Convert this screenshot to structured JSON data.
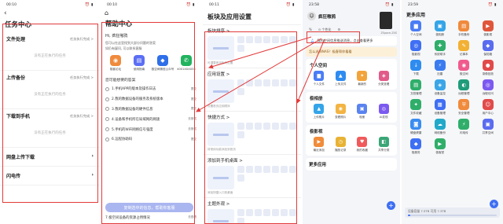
{
  "screen1": {
    "time": "00:10",
    "status_icons": "⏰ ▮",
    "title": "任务中心",
    "sections": [
      {
        "label": "文件处理",
        "right": "任务执行完成 >",
        "empty": "没有正在执行的任务"
      },
      {
        "label": "上传备份",
        "right": "任务执行完成 >",
        "empty": "没有正在执行的任务"
      },
      {
        "label": "下载到手机",
        "right": "任务执行完成 >",
        "empty": "没有正在执行的任务"
      }
    ],
    "items": [
      {
        "label": "网盘上传下载"
      },
      {
        "label": "闪电传"
      }
    ]
  },
  "screen2": {
    "time": "00:10",
    "title": "帮助中心",
    "hi": "Hi, 疯狂嗷鸦",
    "desc1": "您可以在这里找到大部分问题的答案",
    "desc2": "如仍有疑问, 可以联系客服",
    "apps": [
      {
        "label": "极客论坛",
        "icon": "forum-icon",
        "color": "#f08a3c",
        "glyph": "◉"
      },
      {
        "label": "使用指南",
        "icon": "guide-icon",
        "color": "#5b6ef5",
        "glyph": "▤"
      },
      {
        "label": "极空间微信公众号",
        "icon": "wechat-icon",
        "color": "#2f6fe8",
        "glyph": "◆"
      },
      {
        "label": "4001XXXX55",
        "icon": "phone-icon",
        "color": "#22b35e",
        "glyph": "✆"
      }
    ],
    "section": "您可能想要的答案",
    "questions": [
      {
        "label": "1.手机APP的版本及操作日志",
        "btn": "提交"
      },
      {
        "label": "2.我的数据设备的服务及系统版本",
        "btn": "提交"
      },
      {
        "label": "3.我的数据设备的硬件信息",
        "btn": "提交"
      },
      {
        "label": "4.设备和手机所在局域网的网速",
        "btn": "去测试"
      },
      {
        "label": "5.手机的WiFi网络信号强度",
        "btn": "去测试"
      },
      {
        "label": "6.远程协助码",
        "btn": "提交"
      }
    ],
    "big_button": "复制选中的信息，帮助你客服",
    "last_item": "7.极空间设备的资源占用情况",
    "last_btn": "去查看"
  },
  "screen3": {
    "time": "00:11",
    "title": "板块及应用设置",
    "modules": [
      {
        "label": "板块排序 >",
        "hint": "可调整首页板块位置"
      },
      {
        "label": "应用设置 >",
        "hint": "设置首页应用顺序"
      },
      {
        "label": "快捷方式 >",
        "hint": "将常用功能添加到首页"
      },
      {
        "label": "添加到手机桌面 >",
        "hint": "添加快捷入口到桌面"
      },
      {
        "label": "主题外观 >",
        "hint": ""
      }
    ]
  },
  "screen4": {
    "time": "23:58",
    "name": "疯狂嗷鸦",
    "nas_label": "ZSpace-Z4S",
    "stats": [
      "%",
      "⊙ 个性化",
      "⚙"
    ],
    "msg_item": "我的空间信息推送消息，点击查看更多",
    "banner": "怎么选择NAS？极客帮你看看",
    "blocks": [
      {
        "title": "个人空间",
        "apps": [
          {
            "label": "个人文件",
            "color": "#4a7df5",
            "glyph": "▆"
          },
          {
            "label": "上传文件",
            "color": "#2e8cf0",
            "glyph": "▲"
          },
          {
            "label": "最新的",
            "color": "#f2a43a",
            "glyph": "✦"
          },
          {
            "label": "分类查看",
            "color": "#e25a8a",
            "glyph": "◈"
          }
        ]
      },
      {
        "title": "极相册",
        "apps": [
          {
            "label": "上传照片",
            "color": "#34a5e8",
            "glyph": "▲"
          },
          {
            "label": "查看照片",
            "color": "#f3b443",
            "glyph": "◉"
          },
          {
            "label": "相册",
            "color": "#5a83f0",
            "glyph": "▣"
          },
          {
            "label": "AI发现",
            "color": "#7c5af0",
            "glyph": "◎"
          }
        ]
      },
      {
        "title": "极影视",
        "apps": [
          {
            "label": "最近添加",
            "color": "#f08c3a",
            "glyph": "▶"
          },
          {
            "label": "播放记录",
            "color": "#e8b234",
            "glyph": "◷"
          },
          {
            "label": "我的收藏",
            "color": "#f05a5a",
            "glyph": "♥"
          },
          {
            "label": "共享分类",
            "color": "#3aa676",
            "glyph": "◧"
          }
        ]
      }
    ],
    "more_title": "更多应用"
  },
  "screen5": {
    "time": "23:59",
    "title": "更多应用",
    "apps": [
      {
        "label": "个人空间",
        "color": "#4a7df5",
        "glyph": "▆"
      },
      {
        "label": "极相册",
        "color": "#34a5e8",
        "glyph": "▣"
      },
      {
        "label": "手机备份",
        "color": "#f08a3c",
        "glyph": "▤"
      },
      {
        "label": "极影视",
        "color": "#e0563a",
        "glyph": "▶"
      },
      {
        "label": "极影视",
        "color": "#3e6ff4",
        "glyph": "◎"
      },
      {
        "label": "系统助手",
        "color": "#2fae6a",
        "glyph": "✚"
      },
      {
        "label": "记事本",
        "color": "#f2b134",
        "glyph": "✎"
      },
      {
        "label": "保险箱",
        "color": "#5a6cf0",
        "glyph": "◆"
      },
      {
        "label": "下载",
        "color": "#2e8cf0",
        "glyph": "↓"
      },
      {
        "label": "迅雷",
        "color": "#3a7cf0",
        "glyph": "⚡"
      },
      {
        "label": "极空间",
        "color": "#f05a8c",
        "glyph": "◉"
      },
      {
        "label": "录像回放",
        "color": "#e24a4a",
        "glyph": "●"
      },
      {
        "label": "文档管理",
        "color": "#2fae6a",
        "glyph": "▤"
      },
      {
        "label": "设备监控",
        "color": "#3aa6e8",
        "glyph": "◈"
      },
      {
        "label": "远程管理",
        "color": "#1f9c7a",
        "glyph": "◐"
      },
      {
        "label": "远程访问",
        "color": "#7c5af0",
        "glyph": "◎"
      },
      {
        "label": "文件收藏",
        "color": "#2fae6a",
        "glyph": "✦"
      },
      {
        "label": "设备管理",
        "color": "#3e6ff4",
        "glyph": "▦"
      },
      {
        "label": "安全管理",
        "color": "#f08a3c",
        "glyph": "⛨"
      },
      {
        "label": "用户中心",
        "color": "#e24a4a",
        "glyph": "☺"
      },
      {
        "label": "硬盘健康",
        "color": "#3a8cf0",
        "glyph": "◙"
      },
      {
        "label": "网络备份",
        "color": "#22a8c8",
        "glyph": "☁"
      },
      {
        "label": "闪电传",
        "color": "#2fae6a",
        "glyph": "⚡"
      },
      {
        "label": "共享空间",
        "color": "#5a6cf0",
        "glyph": "▣"
      },
      {
        "label": "极服务",
        "color": "#3e6ff4",
        "glyph": "◆"
      },
      {
        "label": "极客堂",
        "color": "#2fae6a",
        "glyph": "▶"
      }
    ],
    "footer": "设备容量 7.5TB  可用 7.3TB",
    "storage_used_fraction": 0.03
  }
}
